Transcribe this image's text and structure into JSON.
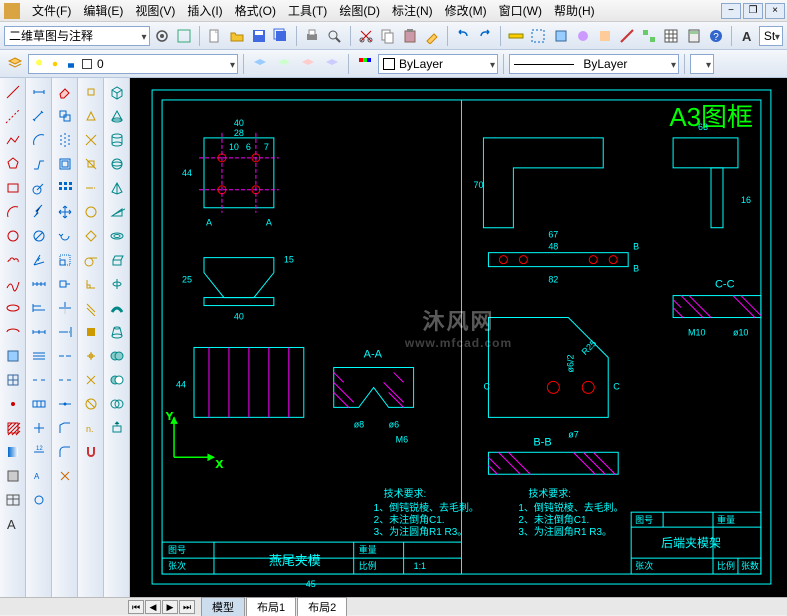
{
  "menu": {
    "items": [
      "文件(F)",
      "编辑(E)",
      "视图(V)",
      "插入(I)",
      "格式(O)",
      "工具(T)",
      "绘图(D)",
      "标注(N)",
      "修改(M)",
      "窗口(W)",
      "帮助(H)"
    ]
  },
  "row1": {
    "workspace": "二维草图与注释",
    "style_label": "St"
  },
  "row2": {
    "layer_value": "0",
    "prop_layer": "ByLayer",
    "linetype": "ByLayer"
  },
  "canvas": {
    "title": "A3图框",
    "tech_req_title": "技术要求:",
    "tech_req_items": [
      "1、倒钝锐棱、去毛刺。",
      "2、未注倒角C1.",
      "3、为注圆角R1 R3。"
    ],
    "block_left_title": "燕尾夹模",
    "block_right_title": "后端夹模架",
    "block_labels": {
      "ratio": "比例",
      "ratio_v": "1:1",
      "fig": "图号",
      "page": "张次",
      "weight": "重量",
      "pages": "张数"
    },
    "section_aa": "A-A",
    "section_bb": "B-B",
    "section_cc": "C-C",
    "dims_left": {
      "w40": "40",
      "w28": "28",
      "h44": "44",
      "g10": "10",
      "g6": "6",
      "g7": "7",
      "h25": "25",
      "h15": "15",
      "d6": "ø6",
      "d8": "ø8",
      "m6": "M6",
      "t45": "45",
      "a": "A"
    },
    "dims_right": {
      "w63": "63",
      "w67": "67",
      "w48": "48",
      "w82": "82",
      "h16": "16",
      "r25": "R25",
      "d62": "ø6/2",
      "d7": "ø7",
      "m10": "M10",
      "d10": "ø10",
      "t70": "70",
      "b": "B",
      "c": "C"
    },
    "axes": {
      "x": "X",
      "y": "Y"
    }
  },
  "tabs": {
    "items": [
      "模型",
      "布局1",
      "布局2"
    ]
  },
  "watermark": {
    "main": "沐风网",
    "sub": "www.mfcad.com"
  },
  "icons": {
    "new": "new-icon",
    "open": "open-icon",
    "save": "save-icon",
    "print": "print-icon",
    "undo": "undo-icon",
    "redo": "redo-icon",
    "cut": "cut-icon",
    "copy": "copy-icon",
    "paste": "paste-icon",
    "line": "line-icon",
    "pline": "pline-icon",
    "circle": "circle-icon",
    "arc": "arc-icon",
    "rect": "rect-icon",
    "hatch": "hatch-icon",
    "text": "text-icon",
    "dim": "dim-icon",
    "move": "move-icon",
    "rotate": "rotate-icon",
    "mirror": "mirror-icon",
    "trim": "trim-icon",
    "extend": "extend-icon",
    "offset": "offset-icon",
    "fillet": "fillet-icon",
    "erase": "erase-icon",
    "explode": "explode-icon",
    "zoom": "zoom-icon",
    "pan": "pan-icon",
    "layer": "layer-icon",
    "props": "props-icon",
    "calc": "calc-icon",
    "help": "help-icon",
    "gear": "gear-icon",
    "light": "light-icon",
    "color": "color-icon"
  }
}
